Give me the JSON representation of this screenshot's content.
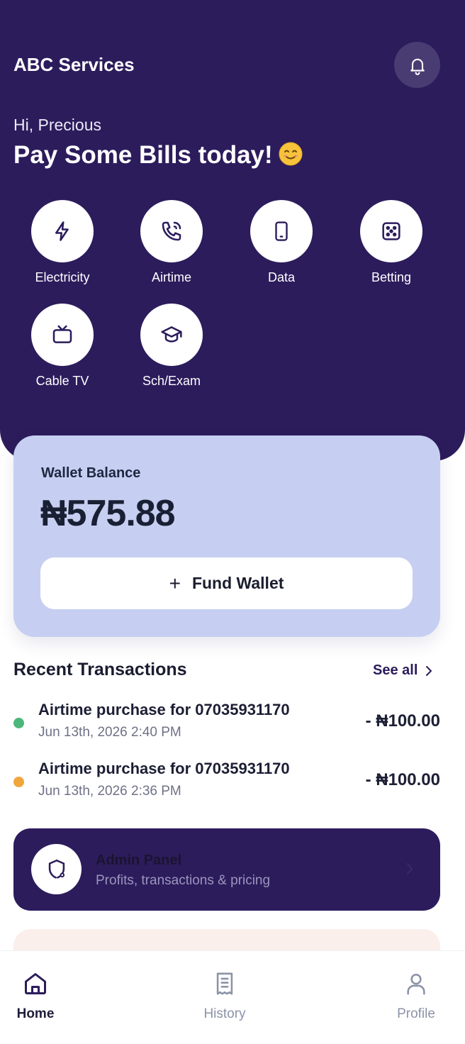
{
  "header": {
    "app_title": "ABC Services",
    "greeting": "Hi, Precious",
    "headline": "Pay Some Bills today!"
  },
  "services": [
    {
      "label": "Electricity",
      "icon": "lightning-icon"
    },
    {
      "label": "Airtime",
      "icon": "phone-call-icon"
    },
    {
      "label": "Data",
      "icon": "smartphone-icon"
    },
    {
      "label": "Betting",
      "icon": "dice-icon"
    },
    {
      "label": "Cable TV",
      "icon": "tv-icon"
    },
    {
      "label": "Sch/Exam",
      "icon": "graduation-cap-icon"
    }
  ],
  "wallet": {
    "label": "Wallet Balance",
    "amount": "₦575.88",
    "fund_label": "Fund Wallet"
  },
  "transactions": {
    "title": "Recent Transactions",
    "see_all": "See all",
    "items": [
      {
        "title": "Airtime purchase for 07035931170",
        "date": "Jun 13th, 2026 2:40 PM",
        "amount": "- ₦100.00",
        "status_color": "#4cb77b"
      },
      {
        "title": "Airtime purchase for 07035931170",
        "date": "Jun 13th, 2026 2:36 PM",
        "amount": "- ₦100.00",
        "status_color": "#f0a63c"
      }
    ]
  },
  "admin": {
    "title": "Admin Panel",
    "subtitle": "Profits, transactions & pricing"
  },
  "nav": {
    "items": [
      {
        "label": "Home",
        "icon": "home-icon",
        "active": true
      },
      {
        "label": "History",
        "icon": "receipt-icon",
        "active": false
      },
      {
        "label": "Profile",
        "icon": "user-icon",
        "active": false
      }
    ]
  },
  "colors": {
    "primary": "#2c1c5c",
    "wallet_card": "#c6cff2",
    "nav_inactive": "#8b93a7"
  }
}
